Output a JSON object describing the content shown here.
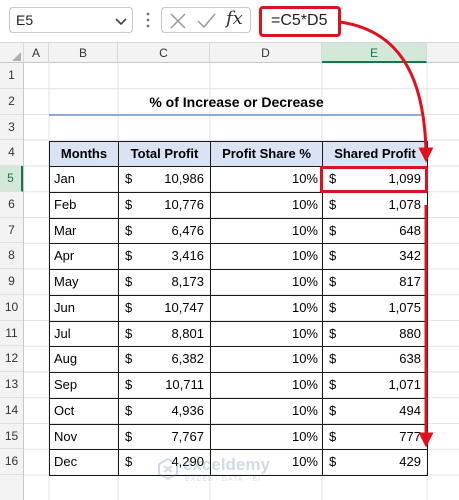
{
  "formula_bar": {
    "name_box": "E5",
    "fx_label": "fx",
    "formula": "=C5*D5"
  },
  "columns": [
    "A",
    "B",
    "C",
    "D",
    "E"
  ],
  "rows": [
    "1",
    "2",
    "3",
    "4",
    "5",
    "6",
    "7",
    "8",
    "9",
    "10",
    "11",
    "12",
    "13",
    "14",
    "15",
    "16"
  ],
  "active": {
    "column": "E",
    "row": "5"
  },
  "title": "% of Increase or Decrease",
  "table": {
    "headers": [
      "Months",
      "Total Profit",
      "Profit Share %",
      "Shared Profit"
    ],
    "currency_symbol": "$",
    "rows": [
      {
        "month": "Jan",
        "total": "10,986",
        "share": "10%",
        "shared": "1,099"
      },
      {
        "month": "Feb",
        "total": "10,776",
        "share": "10%",
        "shared": "1,078"
      },
      {
        "month": "Mar",
        "total": "6,476",
        "share": "10%",
        "shared": "648"
      },
      {
        "month": "Apr",
        "total": "3,416",
        "share": "10%",
        "shared": "342"
      },
      {
        "month": "May",
        "total": "8,173",
        "share": "10%",
        "shared": "817"
      },
      {
        "month": "Jun",
        "total": "10,747",
        "share": "10%",
        "shared": "1,075"
      },
      {
        "month": "Jul",
        "total": "8,801",
        "share": "10%",
        "shared": "880"
      },
      {
        "month": "Aug",
        "total": "6,382",
        "share": "10%",
        "shared": "638"
      },
      {
        "month": "Sep",
        "total": "10,711",
        "share": "10%",
        "shared": "1,071"
      },
      {
        "month": "Oct",
        "total": "4,936",
        "share": "10%",
        "shared": "494"
      },
      {
        "month": "Nov",
        "total": "7,767",
        "share": "10%",
        "shared": "777"
      },
      {
        "month": "Dec",
        "total": "4,290",
        "share": "10%",
        "shared": "429"
      }
    ]
  },
  "watermark": {
    "name": "exceldemy",
    "tagline": "EXCEL · DATA · BI"
  },
  "colors": {
    "highlight": "#e0101f",
    "header_fill": "#dae3f3",
    "active_header": "#107c41"
  }
}
